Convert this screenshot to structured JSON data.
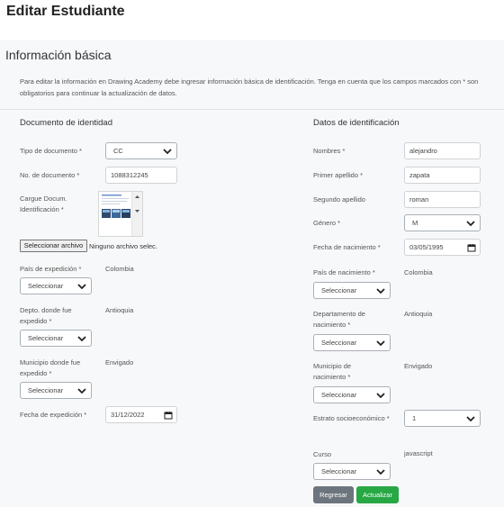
{
  "page": {
    "title": "Editar Estudiante"
  },
  "card": {
    "title": "Información básica",
    "intro": "Para editar la información en Drawing Academy debe ingresar información básica de identificación. Tenga en cuenta que los campos marcados con * son obligatorios para continuar la actualización de datos."
  },
  "left": {
    "title": "Documento de identidad",
    "tipo_doc": {
      "label": "Tipo de documento *",
      "value": "CC"
    },
    "num_doc": {
      "label": "No. de documento *",
      "value": "1088312245"
    },
    "cargue": {
      "label": "Cargue Docum. Identificación *"
    },
    "file": {
      "button": "Seleccionar archivo",
      "status": "Ninguno archivo selec."
    },
    "pais_exp": {
      "label": "País de expedición *",
      "current": "Colombia",
      "select": "Seleccionar"
    },
    "depto_exp": {
      "label": "Depto. donde fue expedido *",
      "current": "Antioquia",
      "select": "Seleccionar"
    },
    "muni_exp": {
      "label": "Municipio donde fue expedido *",
      "current": "Envigado",
      "select": "Seleccionar"
    },
    "fecha_exp": {
      "label": "Fecha de expedición *",
      "value": "31/12/2022"
    }
  },
  "right": {
    "title": "Datos de identificación",
    "nombres": {
      "label": "Nombres *",
      "value": "alejandro"
    },
    "primer_apellido": {
      "label": "Primer apellido *",
      "value": "zapata"
    },
    "segundo_apellido": {
      "label": "Segundo apellido",
      "value": "roman"
    },
    "genero": {
      "label": "Género *",
      "value": "M"
    },
    "fecha_nac": {
      "label": "Fecha de nacimiento *",
      "value": "03/05/1995"
    },
    "pais_nac": {
      "label": "País de nacimiento *",
      "current": "Colombia",
      "select": "Seleccionar"
    },
    "depto_nac": {
      "label": "Departamento de nacimiento *",
      "current": "Antioquia",
      "select": "Seleccionar"
    },
    "muni_nac": {
      "label": "Municipio de nacimiento *",
      "current": "Envigado",
      "select": "Seleccionar"
    },
    "estrato": {
      "label": "Estrato socioeconómico *",
      "value": "1"
    },
    "curso": {
      "label": "Curso",
      "current": "javascript",
      "select": "Seleccionar"
    }
  },
  "actions": {
    "back": "Regresar",
    "save": "Actualizar"
  },
  "colors": {
    "save": "#28a745",
    "back": "#6c757d"
  }
}
